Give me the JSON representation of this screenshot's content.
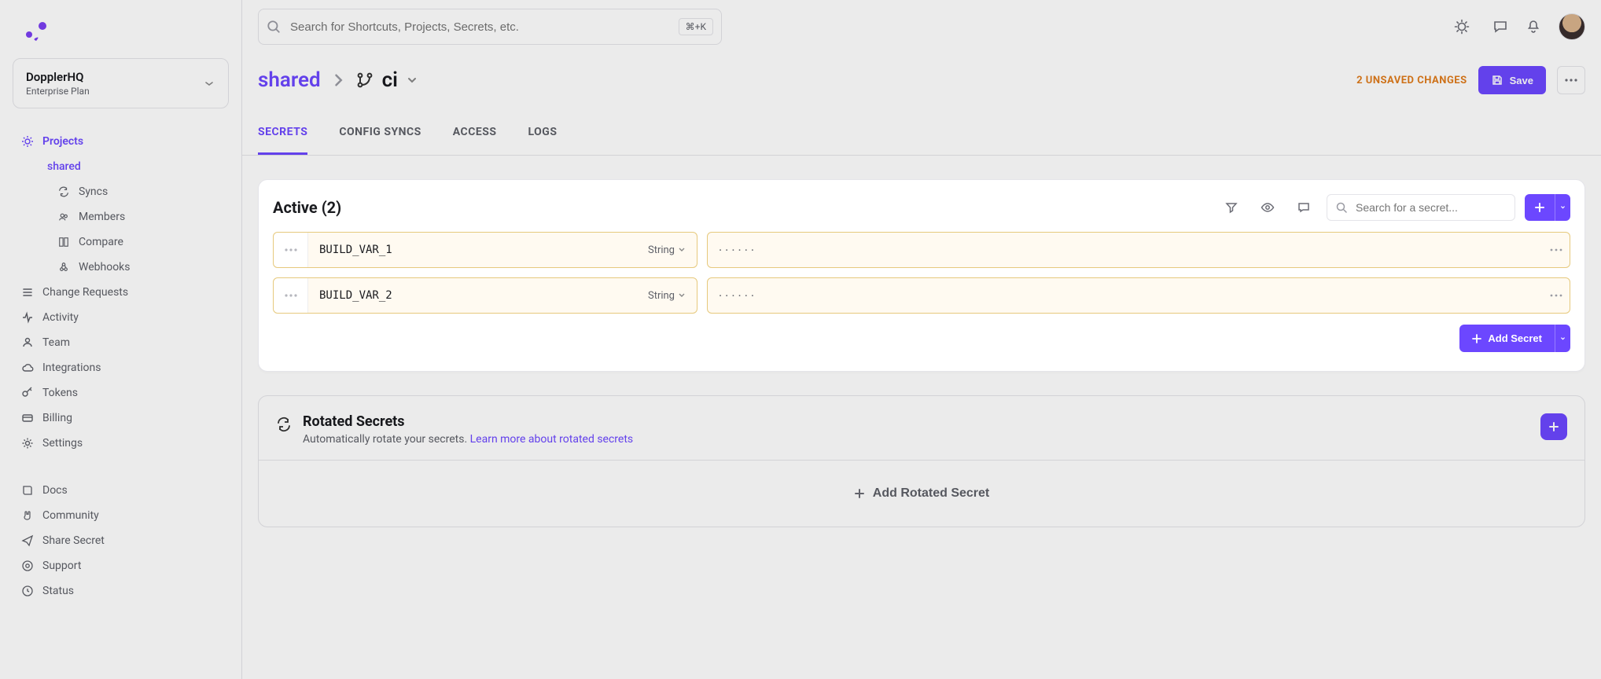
{
  "org": {
    "name": "DopplerHQ",
    "plan": "Enterprise Plan"
  },
  "search": {
    "placeholder": "Search for Shortcuts, Projects, Secrets, etc.",
    "kbd": "⌘+K"
  },
  "sidebar": {
    "projects_label": "Projects",
    "project_name": "shared",
    "sub": {
      "syncs": "Syncs",
      "members": "Members",
      "compare": "Compare",
      "webhooks": "Webhooks"
    },
    "items": {
      "change_requests": "Change Requests",
      "activity": "Activity",
      "team": "Team",
      "integrations": "Integrations",
      "tokens": "Tokens",
      "billing": "Billing",
      "settings": "Settings"
    },
    "footer": {
      "docs": "Docs",
      "community": "Community",
      "share_secret": "Share Secret",
      "support": "Support",
      "status": "Status"
    }
  },
  "breadcrumb": {
    "project": "shared",
    "config": "ci"
  },
  "actions": {
    "unsaved": "2 UNSAVED CHANGES",
    "save": "Save"
  },
  "tabs": {
    "secrets": "SECRETS",
    "config_syncs": "CONFIG SYNCS",
    "access": "ACCESS",
    "logs": "LOGS"
  },
  "panel": {
    "title": "Active (2)",
    "secret_search_placeholder": "Search for a secret...",
    "secrets": [
      {
        "key": "BUILD_VAR_1",
        "type": "String",
        "value_masked": "······"
      },
      {
        "key": "BUILD_VAR_2",
        "type": "String",
        "value_masked": "······"
      }
    ],
    "add_secret_label": "Add Secret"
  },
  "rotated": {
    "title": "Rotated Secrets",
    "subtitle_pre": "Automatically rotate your secrets. ",
    "learn_more": "Learn more about rotated secrets",
    "add_label": "Add Rotated Secret"
  }
}
